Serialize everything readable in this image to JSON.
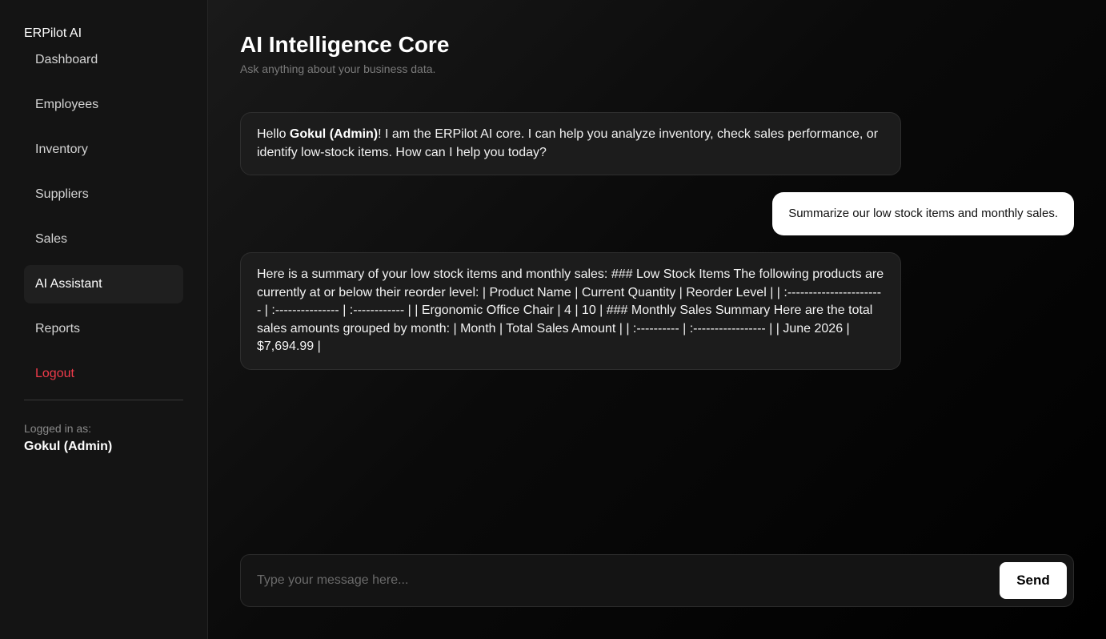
{
  "sidebar": {
    "brand": "ERPilot AI",
    "items": [
      {
        "label": "Dashboard"
      },
      {
        "label": "Employees"
      },
      {
        "label": "Inventory"
      },
      {
        "label": "Suppliers"
      },
      {
        "label": "Sales"
      },
      {
        "label": "AI Assistant"
      },
      {
        "label": "Reports"
      },
      {
        "label": "Logout"
      }
    ],
    "active_item": "AI Assistant",
    "logged_in_label": "Logged in as:",
    "logged_in_user": "Gokul (Admin)"
  },
  "header": {
    "title": "AI Intelligence Core",
    "subtitle": "Ask anything about your business data."
  },
  "chat": {
    "greeting": {
      "prefix": "Hello ",
      "user": "Gokul (Admin)",
      "suffix": "! I am the ERPilot AI core. I can help you analyze inventory, check sales performance, or identify low-stock items. How can I help you today?"
    },
    "user_message": "Summarize our low stock items and monthly sales.",
    "ai_response": "Here is a summary of your low stock items and monthly sales: ### Low Stock Items The following products are currently at or below their reorder level: | Product Name | Current Quantity | Reorder Level | | :----------------------- | :--------------- | :------------ | | Ergonomic Office Chair | 4 | 10 | ### Monthly Sales Summary Here are the total sales amounts grouped by month: | Month | Total Sales Amount | | :---------- | :----------------- | | June 2026 | $7,694.99 |"
  },
  "composer": {
    "placeholder": "Type your message here...",
    "value": "",
    "send_label": "Send"
  },
  "colors": {
    "accent": "#ffffff",
    "logout": "#ef3b4a",
    "sidebar_bg": "#141414",
    "bubble_bg": "#1c1c1c"
  }
}
